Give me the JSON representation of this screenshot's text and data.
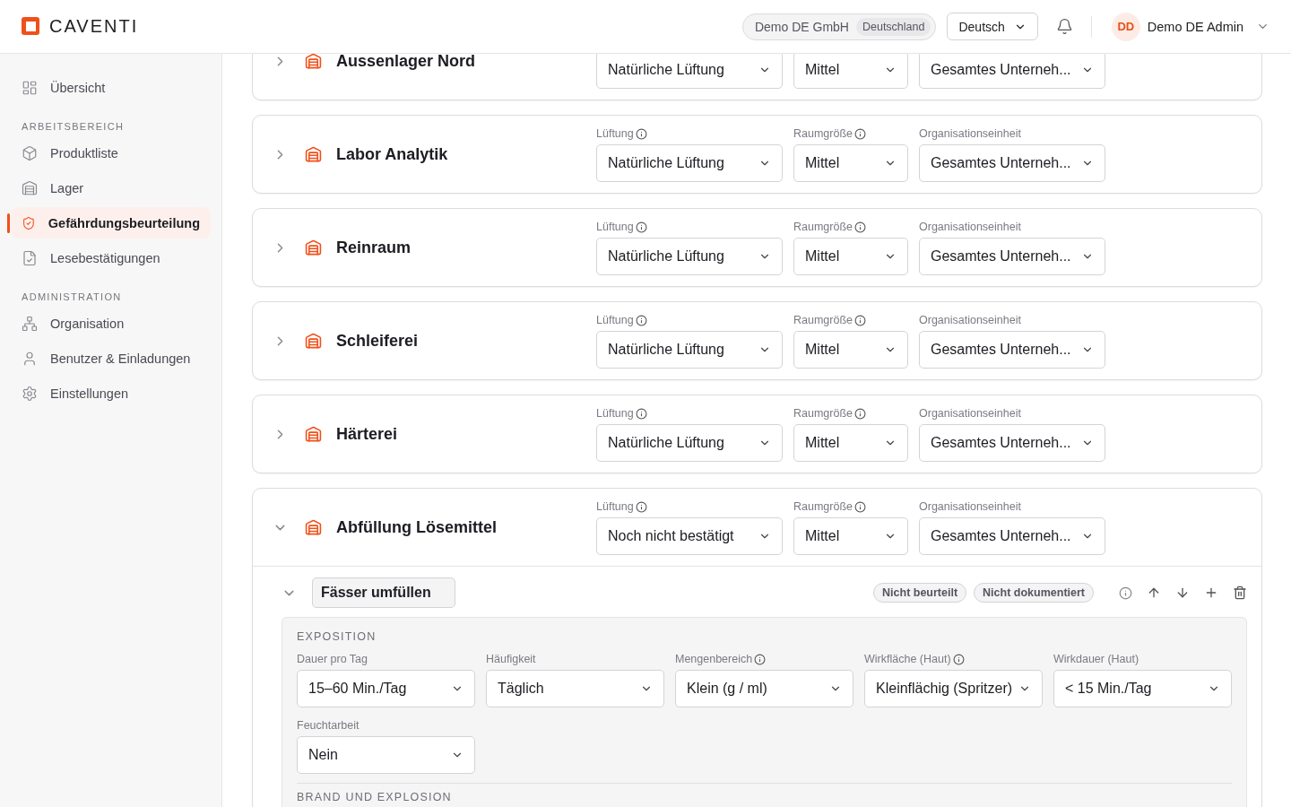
{
  "header": {
    "logo": "CAVENTI",
    "company": "Demo DE GmbH",
    "country": "Deutschland",
    "language": "Deutsch",
    "user_initials": "DD",
    "user_name": "Demo DE Admin"
  },
  "sidebar": {
    "sections": [
      {
        "items": [
          {
            "label": "Übersicht",
            "selected": false
          }
        ]
      },
      {
        "title": "ARBEITSBEREICH",
        "items": [
          {
            "label": "Produktliste",
            "selected": false
          },
          {
            "label": "Lager",
            "selected": false
          },
          {
            "label": "Gefährdungsbeurteilung",
            "selected": true
          },
          {
            "label": "Lesebestätigungen",
            "selected": false
          }
        ]
      },
      {
        "title": "ADMINISTRATION",
        "items": [
          {
            "label": "Organisation",
            "selected": false
          },
          {
            "label": "Benutzer & Einladungen",
            "selected": false
          },
          {
            "label": "Einstellungen",
            "selected": false
          }
        ]
      }
    ]
  },
  "areas": [
    {
      "name": "Aussenlager Nord",
      "expanded": false,
      "fields": [
        {
          "value": "Natürliche Lüftung"
        },
        {
          "value": "Mittel"
        },
        {
          "value": "Gesamtes Unterneh..."
        }
      ]
    },
    {
      "name": "Labor Analytik",
      "expanded": false,
      "fields": [
        {
          "label": "Lüftung",
          "info": true,
          "value": "Natürliche Lüftung"
        },
        {
          "label": "Raumgröße",
          "info": true,
          "value": "Mittel"
        },
        {
          "label": "Organisationseinheit",
          "info": false,
          "value": "Gesamtes Unterneh..."
        }
      ]
    },
    {
      "name": "Reinraum",
      "expanded": false,
      "fields": [
        {
          "label": "Lüftung",
          "info": true,
          "value": "Natürliche Lüftung"
        },
        {
          "label": "Raumgröße",
          "info": true,
          "value": "Mittel"
        },
        {
          "label": "Organisationseinheit",
          "info": false,
          "value": "Gesamtes Unterneh..."
        }
      ]
    },
    {
      "name": "Schleiferei",
      "expanded": false,
      "fields": [
        {
          "label": "Lüftung",
          "info": true,
          "value": "Natürliche Lüftung"
        },
        {
          "label": "Raumgröße",
          "info": true,
          "value": "Mittel"
        },
        {
          "label": "Organisationseinheit",
          "info": false,
          "value": "Gesamtes Unterneh..."
        }
      ]
    },
    {
      "name": "Härterei",
      "expanded": false,
      "fields": [
        {
          "label": "Lüftung",
          "info": true,
          "value": "Natürliche Lüftung"
        },
        {
          "label": "Raumgröße",
          "info": true,
          "value": "Mittel"
        },
        {
          "label": "Organisationseinheit",
          "info": false,
          "value": "Gesamtes Unterneh..."
        }
      ]
    },
    {
      "name": "Abfüllung Lösemittel",
      "expanded": true,
      "fields": [
        {
          "label": "Lüftung",
          "info": true,
          "value": "Noch nicht bestätigt"
        },
        {
          "label": "Raumgröße",
          "info": true,
          "value": "Mittel"
        },
        {
          "label": "Organisationseinheit",
          "info": false,
          "value": "Gesamtes Unterneh..."
        }
      ],
      "activity": {
        "name": "Fässer umfüllen",
        "expanded": true,
        "badges": [
          "Nicht beurteilt",
          "Nicht dokumentiert"
        ],
        "sections": [
          {
            "title": "EXPOSITION",
            "fields": [
              {
                "label": "Dauer pro Tag",
                "info": false,
                "value": "15–60 Min./Tag"
              },
              {
                "label": "Häufigkeit",
                "info": false,
                "value": "Täglich"
              },
              {
                "label": "Mengenbereich",
                "info": true,
                "value": "Klein (g / ml)"
              },
              {
                "label": "Wirkfläche (Haut)",
                "info": true,
                "value": "Kleinflächig (Spritzer)"
              },
              {
                "label": "Wirkdauer (Haut)",
                "info": false,
                "value": "< 15 Min./Tag"
              },
              {
                "label": "Feuchtarbeit",
                "info": false,
                "value": "Nein"
              }
            ]
          },
          {
            "title": "BRAND UND EXPLOSION"
          }
        ]
      }
    }
  ]
}
